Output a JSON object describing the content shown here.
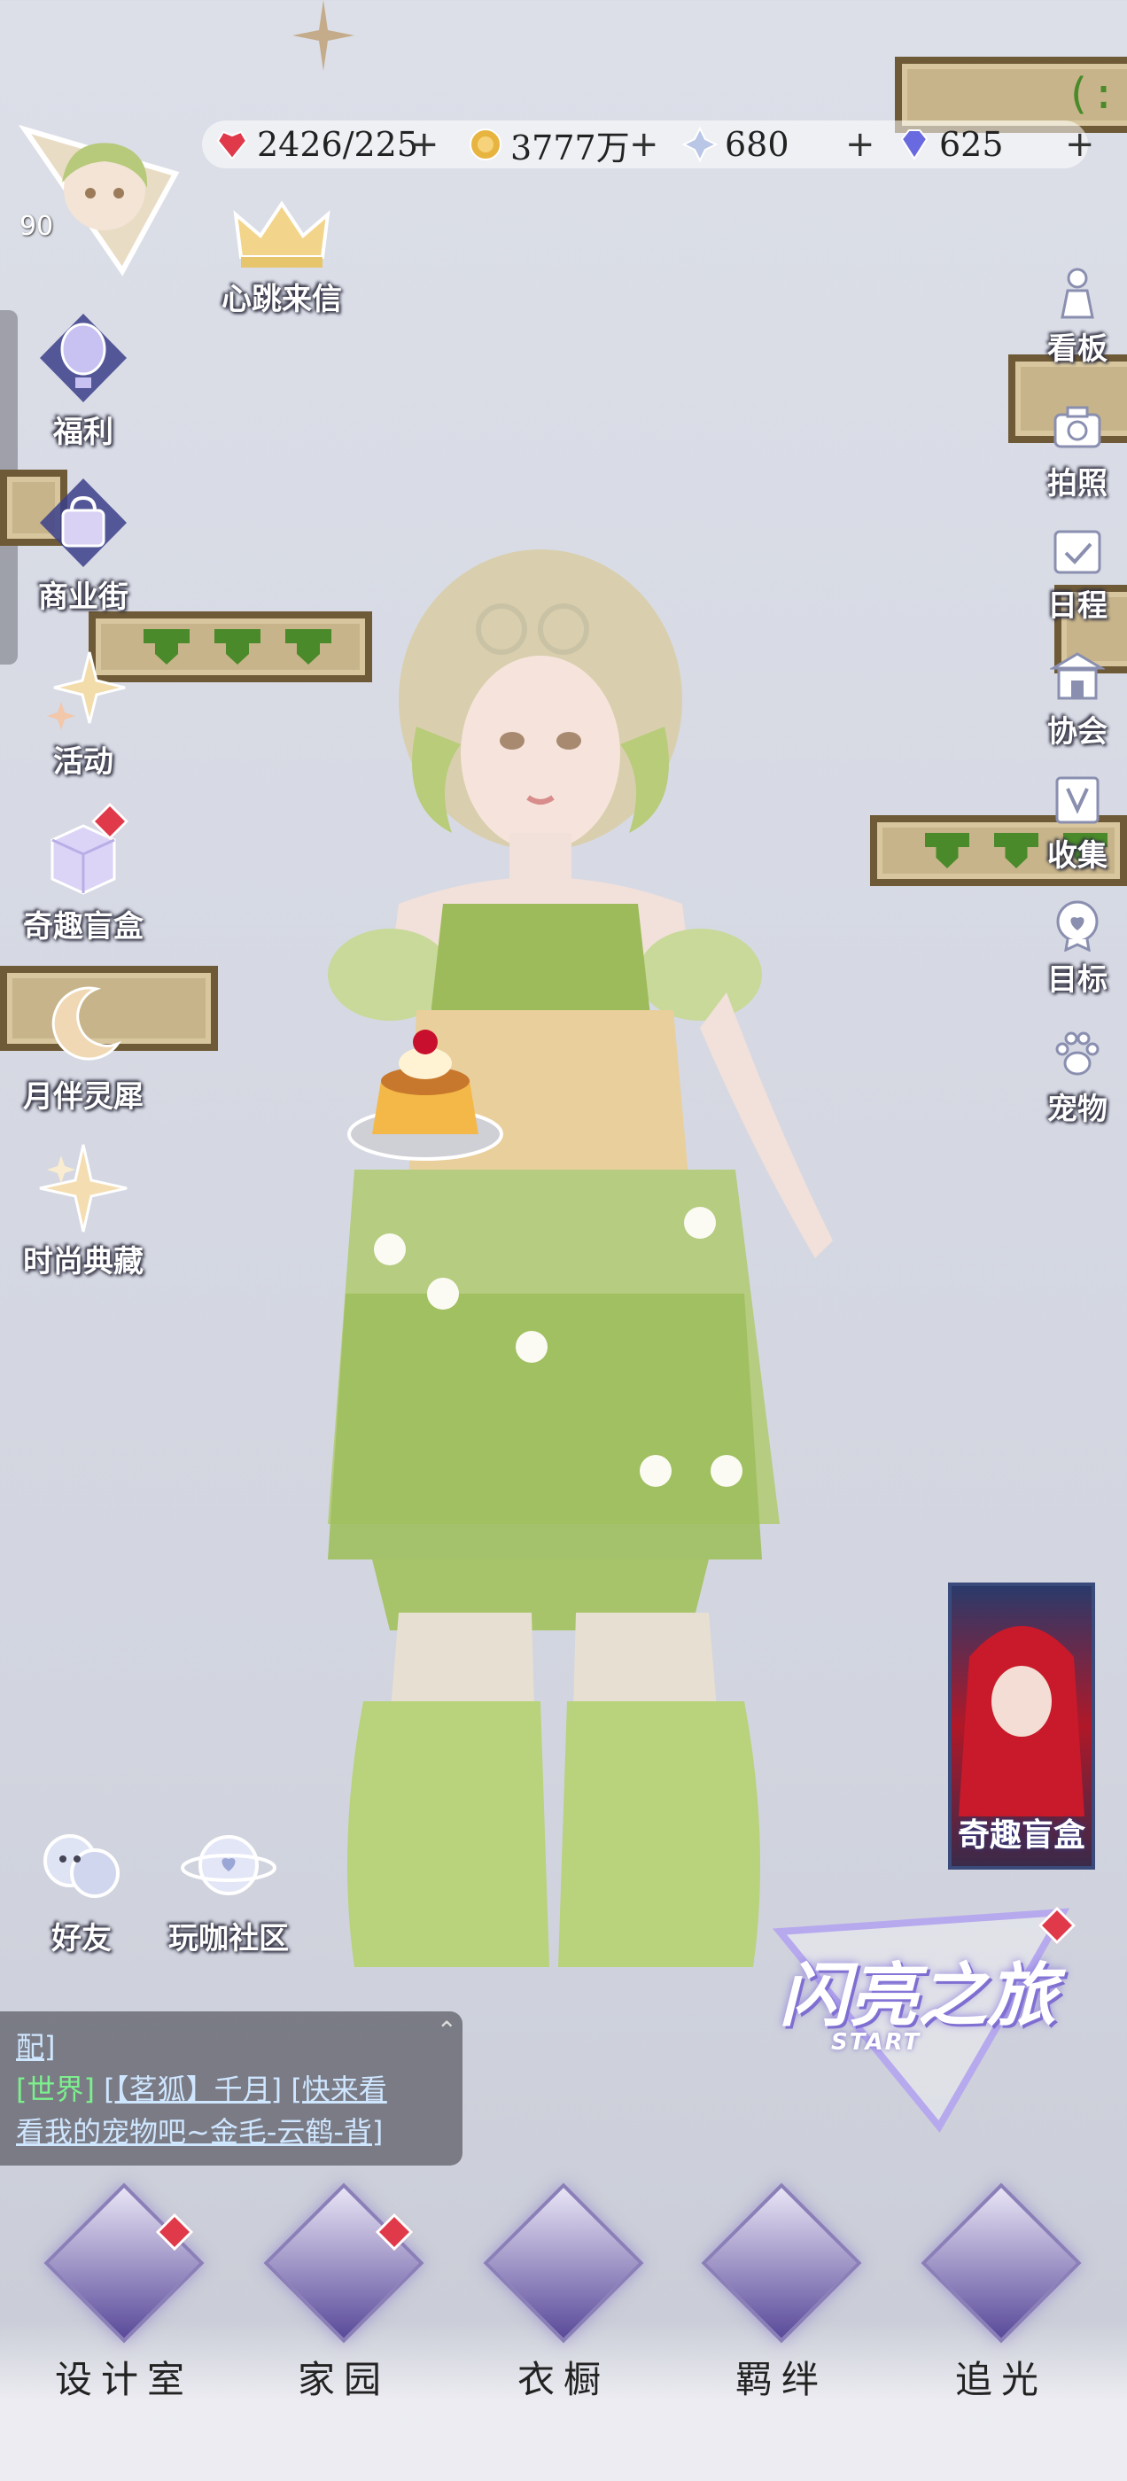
{
  "currency": {
    "stamina": "2426/225",
    "gold": "3777万",
    "crystal": "680",
    "diamond": "625"
  },
  "player": {
    "level": "90"
  },
  "top_event": {
    "label": "心跳来信"
  },
  "left_menu": [
    {
      "label": "福利",
      "icon": "hot-air-balloon-icon"
    },
    {
      "label": "商业街",
      "icon": "shopping-bag-icon"
    },
    {
      "label": "活动",
      "icon": "sparkle-star-icon"
    },
    {
      "label": "奇趣盲盒",
      "icon": "mystery-box-icon"
    },
    {
      "label": "月伴灵犀",
      "icon": "moon-icon"
    },
    {
      "label": "时尚典藏",
      "icon": "star-burst-icon"
    }
  ],
  "right_menu": [
    {
      "label": "看板",
      "icon": "figure-icon"
    },
    {
      "label": "拍照",
      "icon": "camera-icon"
    },
    {
      "label": "日程",
      "icon": "calendar-icon"
    },
    {
      "label": "协会",
      "icon": "guild-hall-icon"
    },
    {
      "label": "收集",
      "icon": "collection-icon"
    },
    {
      "label": "目标",
      "icon": "target-badge-icon"
    },
    {
      "label": "宠物",
      "icon": "paw-icon"
    }
  ],
  "social": [
    {
      "label": "好友",
      "icon": "friends-icon"
    },
    {
      "label": "玩咖社区",
      "icon": "community-planet-icon"
    }
  ],
  "promo_card": {
    "text": "奇趣盲盒"
  },
  "journey": {
    "title": "闪亮之旅",
    "subtitle": "START"
  },
  "chat": {
    "line1": "配]",
    "channel": "[世界]",
    "message_a": "[【茗狐】千月]",
    "message_b": "[快来看",
    "line3": "看我的宠物吧~金毛-云鹤-背]"
  },
  "bottom_nav": [
    {
      "label": "设计室",
      "icon": "moon-crest-icon",
      "badge": true
    },
    {
      "label": "家园",
      "icon": "key-icon",
      "badge": true
    },
    {
      "label": "衣橱",
      "icon": "snowflake-icon",
      "badge": false
    },
    {
      "label": "羁绊",
      "icon": "clover-icon",
      "badge": false
    },
    {
      "label": "追光",
      "icon": "butterfly-icon",
      "badge": false
    }
  ],
  "colors": {
    "accent": "#6a5acd",
    "badge": "#e0394a",
    "chat_world": "#7cf08c"
  }
}
